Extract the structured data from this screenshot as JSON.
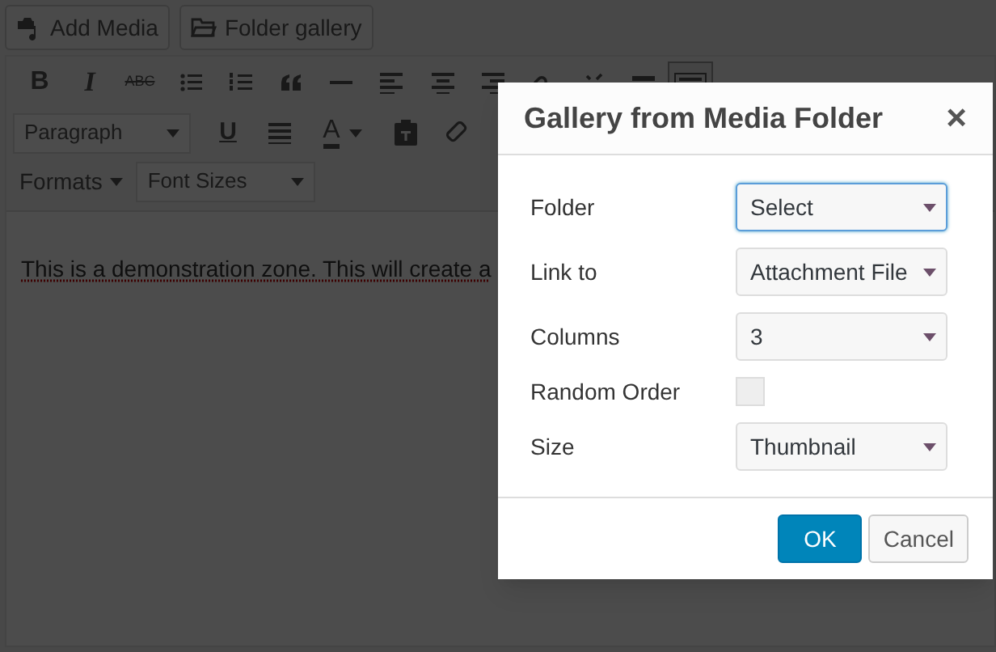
{
  "media_buttons": [
    {
      "label": "Add Media",
      "kind": "media"
    },
    {
      "label": "Folder gallery",
      "kind": "folder"
    }
  ],
  "toolbar": {
    "bold": "B",
    "italic": "I",
    "strikethrough": "ABC",
    "format_select": "Paragraph",
    "underline": "U",
    "text_color": "A",
    "formats_menu": "Formats",
    "font_sizes_select": "Font Sizes"
  },
  "content": {
    "text": "This is a demonstration zone. This will create a"
  },
  "dialog": {
    "title": "Gallery from Media Folder",
    "close": "×",
    "fields": [
      {
        "label": "Folder",
        "kind": "select",
        "value": "Select",
        "focused": true
      },
      {
        "label": "Link to",
        "kind": "select",
        "value": "Attachment File",
        "focused": false
      },
      {
        "label": "Columns",
        "kind": "select",
        "value": "3",
        "focused": false
      },
      {
        "label": "Random Order",
        "kind": "checkbox",
        "checked": false
      },
      {
        "label": "Size",
        "kind": "select",
        "value": "Thumbnail",
        "focused": false
      }
    ],
    "buttons": [
      {
        "label": "OK",
        "kind": "primary"
      },
      {
        "label": "Cancel",
        "kind": "secondary"
      }
    ]
  }
}
